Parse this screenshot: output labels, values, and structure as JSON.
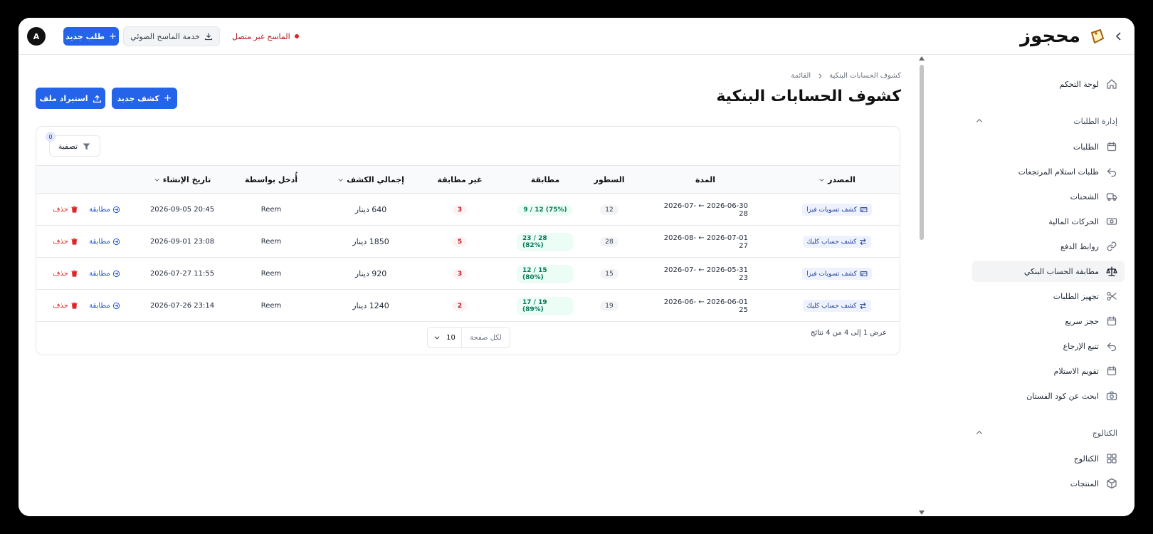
{
  "topbar": {
    "avatar_letter": "A",
    "new_order_label": "طلب جديد",
    "scanner_service_label": "خدمة الماسح الضوئي",
    "scanner_status": "الماسح غير متصل",
    "brand_name": "محجوز"
  },
  "sidebar": {
    "dashboard": "لوحة التحكم",
    "orders_section": "إدارة الطلبات",
    "items": [
      {
        "label": "الطلبات",
        "icon": "calendar-icon"
      },
      {
        "label": "طلبات استلام المرتجعات",
        "icon": "undo-icon"
      },
      {
        "label": "الشحنات",
        "icon": "truck-icon"
      },
      {
        "label": "الحركات المالية",
        "icon": "cash-icon"
      },
      {
        "label": "روابط الدفع",
        "icon": "link-icon"
      },
      {
        "label": "مطابقة الحساب البنكي",
        "icon": "scale-icon"
      },
      {
        "label": "تجهيز الطلبات",
        "icon": "scissors-icon"
      },
      {
        "label": "حجز سريع",
        "icon": "calendar-icon"
      },
      {
        "label": "تتبع الإرجاع",
        "icon": "undo-icon"
      },
      {
        "label": "تقويم الاستلام",
        "icon": "calendar-icon"
      },
      {
        "label": "ابحث عن كود الفستان",
        "icon": "camera-icon"
      }
    ],
    "catalog_section": "الكتالوج",
    "catalog_items": [
      {
        "label": "الكتالوج",
        "icon": "grid-icon"
      },
      {
        "label": "المنتجات",
        "icon": "box-icon"
      }
    ]
  },
  "page": {
    "breadcrumb_parent": "القائمة",
    "breadcrumb_current": "كشوف الحسابات البنكية",
    "title": "كشوف الحسابات البنكية",
    "new_statement_label": "كشف جديد",
    "import_file_label": "استيراد ملف",
    "filter_label": "تصفية",
    "filter_count": "0"
  },
  "table": {
    "headers": {
      "source": "المصدر",
      "period": "المدة",
      "lines": "السطور",
      "matched": "مطابقة",
      "unmatched": "غير مطابقة",
      "total": "إجمالي الكشف",
      "entered_by": "أُدخل بواسطة",
      "created_at": "تاريخ الإنشاء"
    },
    "rows": [
      {
        "source": "كشف تسويات فيزا",
        "source_icon": "card-icon",
        "period": "2026-06-30 ← 2026-07-28",
        "lines": "12",
        "matched": "9 / 12 (75%)",
        "unmatched": "3",
        "total": "640 دينار",
        "entered_by": "Reem",
        "created_at": "2026-09-05 20:45",
        "match_action": "مطابقة",
        "delete_action": "حذف"
      },
      {
        "source": "كشف حساب كليك",
        "source_icon": "transfer-icon",
        "period": "2026-07-01 ← 2026-08-27",
        "lines": "28",
        "matched": "23 / 28 (82%)",
        "unmatched": "5",
        "total": "1850 دينار",
        "entered_by": "Reem",
        "created_at": "2026-09-01 23:08",
        "match_action": "مطابقة",
        "delete_action": "حذف"
      },
      {
        "source": "كشف تسويات فيزا",
        "source_icon": "card-icon",
        "period": "2026-05-31 ← 2026-07-23",
        "lines": "15",
        "matched": "12 / 15 (80%)",
        "unmatched": "3",
        "total": "920 دينار",
        "entered_by": "Reem",
        "created_at": "2026-07-27 11:55",
        "match_action": "مطابقة",
        "delete_action": "حذف"
      },
      {
        "source": "كشف حساب كليك",
        "source_icon": "transfer-icon",
        "period": "2026-06-01 ← 2026-06-25",
        "lines": "19",
        "matched": "17 / 19 (89%)",
        "unmatched": "2",
        "total": "1240 دينار",
        "entered_by": "Reem",
        "created_at": "2026-07-26 23:14",
        "match_action": "مطابقة",
        "delete_action": "حذف"
      }
    ],
    "footer_text": "عرض 1 إلى 4 من 4 نتائج",
    "per_page_label": "لكل صفحة",
    "per_page_value": "10"
  },
  "colors": {
    "primary": "#2563eb",
    "danger": "#dc2626",
    "success": "#047857"
  }
}
